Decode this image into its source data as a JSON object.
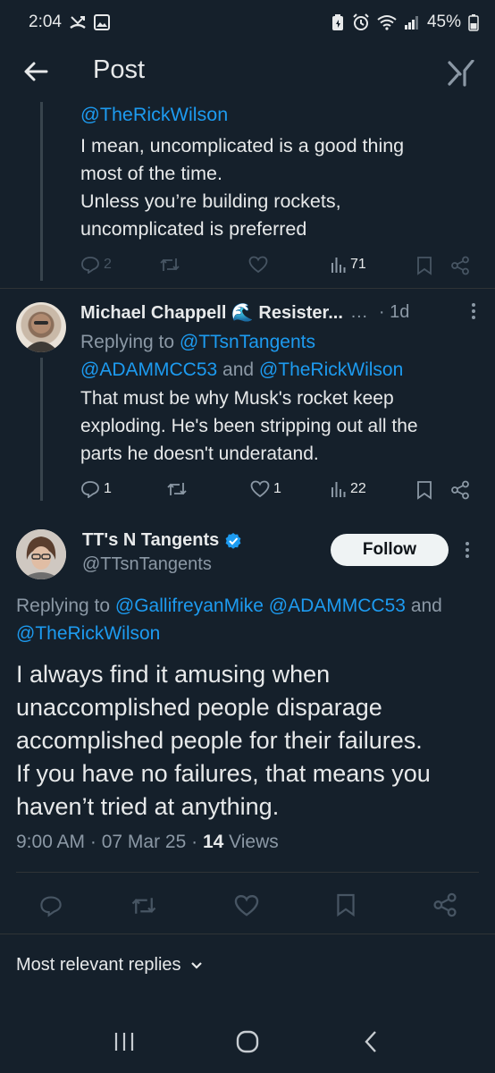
{
  "status": {
    "time": "2:04",
    "battery": "45%"
  },
  "header": {
    "title": "Post"
  },
  "reply1": {
    "mention": "@TheRickWilson",
    "lines": [
      "I mean, uncomplicated is a good thing",
      "most of the time.",
      "Unless you’re building rockets,",
      "uncomplicated is preferred"
    ],
    "replies": "2",
    "views": "71"
  },
  "reply2": {
    "name": "Michael Chappell 🌊 Resister...",
    "time": "· 1d",
    "replying_prefix": "Replying to",
    "replying_to_1": "@TTsnTangents",
    "replying_to_2": "@ADAMMCC53",
    "replying_and": "and",
    "replying_to_3": "@TheRickWilson",
    "lines": [
      "That must be why Musk's rocket keep",
      "exploding. He's been stripping out all the",
      "parts he doesn't underatand."
    ],
    "replies": "1",
    "likes": "1",
    "views": "22"
  },
  "main": {
    "name": "TT's N Tangents",
    "handle": "@TTsnTangents",
    "follow_label": "Follow",
    "replying_prefix": "Replying to",
    "replying_to_1": "@GallifreyanMike",
    "replying_to_2": "@ADAMMCC53",
    "replying_and": "and",
    "replying_to_3": "@TheRickWilson",
    "lines": [
      "I always find it amusing when",
      "unaccomplished people disparage",
      "accomplished people for their failures.",
      "If you have no failures, that means you",
      "haven’t tried at anything."
    ],
    "timestamp": "9:00 AM · 07 Mar 25 ·",
    "views_count": "14",
    "views_label": "Views"
  },
  "replies_filter": {
    "label": "Most relevant replies"
  },
  "colors": {
    "background": "#15202b",
    "accent": "#1d9bf0",
    "muted": "#8b98a5",
    "verified": "#1d9bf0"
  },
  "icons": [
    "back-arrow-icon",
    "grok-icon",
    "reply-icon",
    "retweet-icon",
    "like-icon",
    "views-icon",
    "bookmark-icon",
    "share-icon",
    "verified-icon",
    "more-icon",
    "chevron-down-icon"
  ]
}
